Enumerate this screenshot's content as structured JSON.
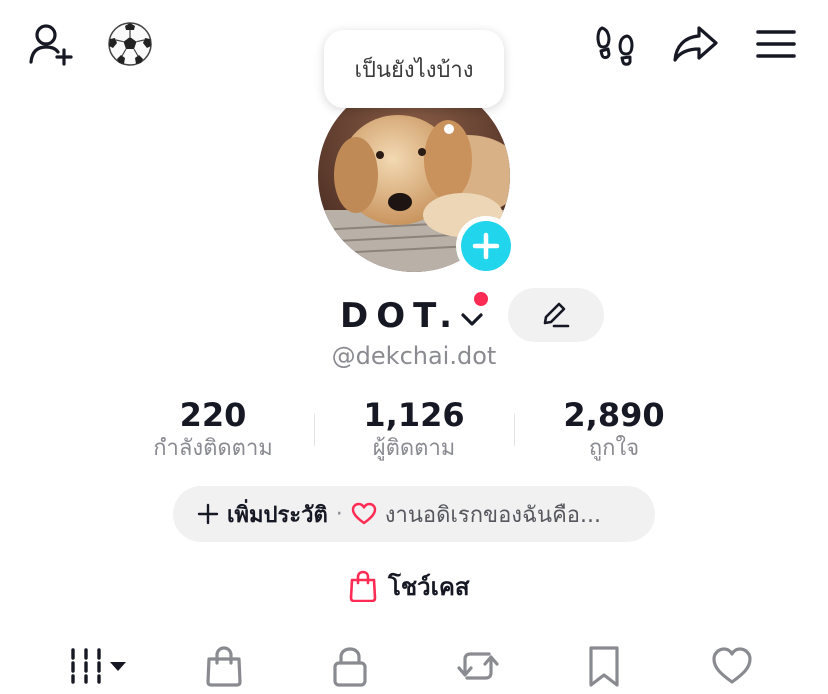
{
  "status_bubble": {
    "text": "เป็นยังไงบ้าง"
  },
  "profile": {
    "display_name": "DOT.",
    "username": "@dekchai.dot"
  },
  "stats": [
    {
      "value": "220",
      "label": "กำลังติดตาม"
    },
    {
      "value": "1,126",
      "label": "ผู้ติดตาม"
    },
    {
      "value": "2,890",
      "label": "ถูกใจ"
    }
  ],
  "bio": {
    "add_label": "เพิ่มประวัติ",
    "separator": "·",
    "text": "งานอดิเรกของฉันคือ..."
  },
  "showcase": {
    "label": "โชว์เคส"
  },
  "icons": {
    "top_left": [
      "add-friend-icon",
      "soccer-ball-icon"
    ],
    "top_right": [
      "footprints-icon",
      "share-icon",
      "menu-icon"
    ],
    "tabs": [
      "videos-grid-icon",
      "shop-bag-icon",
      "lock-icon",
      "repost-icon",
      "bookmark-icon",
      "heart-icon"
    ]
  },
  "colors": {
    "accent_cyan": "#20d5ec",
    "accent_red": "#fe2c55",
    "text_primary": "#161823",
    "text_secondary": "#8a8b91",
    "pill_bg": "#f1f1f2"
  }
}
